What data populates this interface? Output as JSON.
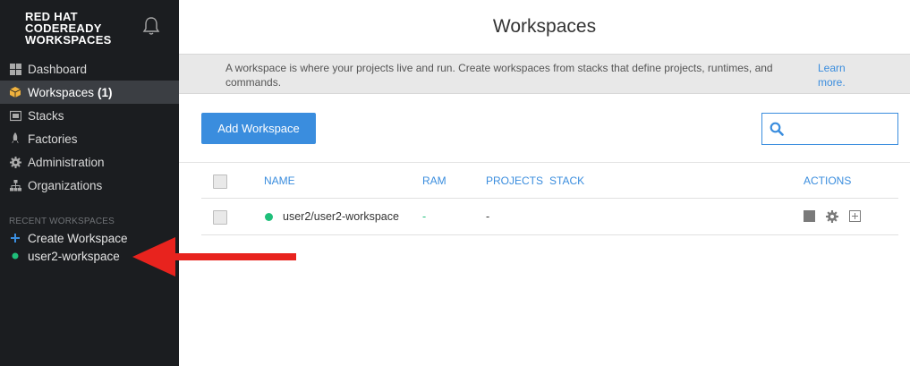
{
  "sidebar": {
    "logo_line1": "RED HAT",
    "logo_line2": "CODEREADY",
    "logo_line3": "WORKSPACES",
    "nav": [
      {
        "label": "Dashboard",
        "icon": "dashboard-icon"
      },
      {
        "label": "Workspaces",
        "count": "(1)",
        "icon": "cube-icon"
      },
      {
        "label": "Stacks",
        "icon": "stack-icon"
      },
      {
        "label": "Factories",
        "icon": "rocket-icon"
      },
      {
        "label": "Administration",
        "icon": "gear-icon"
      },
      {
        "label": "Organizations",
        "icon": "sitemap-icon"
      }
    ],
    "recent_title": "RECENT WORKSPACES",
    "recent": [
      {
        "label": "Create Workspace",
        "icon": "plus-icon"
      },
      {
        "label": "user2-workspace",
        "icon": "status-dot-icon"
      }
    ]
  },
  "main": {
    "title": "Workspaces",
    "info_text": "A workspace is where your projects live and run. Create workspaces from stacks that define projects, runtimes, and commands.",
    "info_link": "Learn more.",
    "add_button": "Add Workspace",
    "search": {
      "value": "",
      "placeholder": ""
    },
    "table": {
      "headers": {
        "name": "NAME",
        "ram": "RAM",
        "projects": "PROJECTS",
        "stack": "STACK",
        "actions": "ACTIONS"
      },
      "rows": [
        {
          "name": "user2/user2-workspace",
          "ram": "-",
          "projects": "-",
          "stack": "",
          "status": "running"
        }
      ]
    }
  },
  "colors": {
    "sidebar_bg": "#1b1d20",
    "accent": "#3a8dde",
    "running_green": "#1fbf7a",
    "annotation_arrow": "#e8231e"
  }
}
